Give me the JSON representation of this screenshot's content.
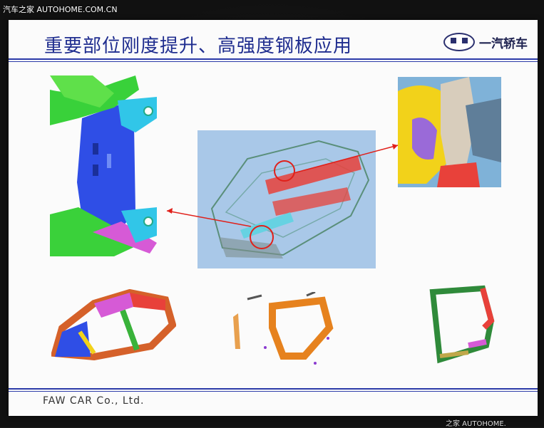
{
  "watermark_top": "汽车之家  AUTOHOME.COM.CN",
  "watermark_bottom": "之家  AUTOHOME.",
  "slide": {
    "title": "重要部位刚度提升、高强度钢板应用",
    "logo_text": "一汽轿车",
    "footer": "FAW CAR Co., Ltd."
  },
  "colors": {
    "title": "#1f2d8f",
    "rule": "#2b3aa8",
    "highlight": "#e0201a"
  }
}
